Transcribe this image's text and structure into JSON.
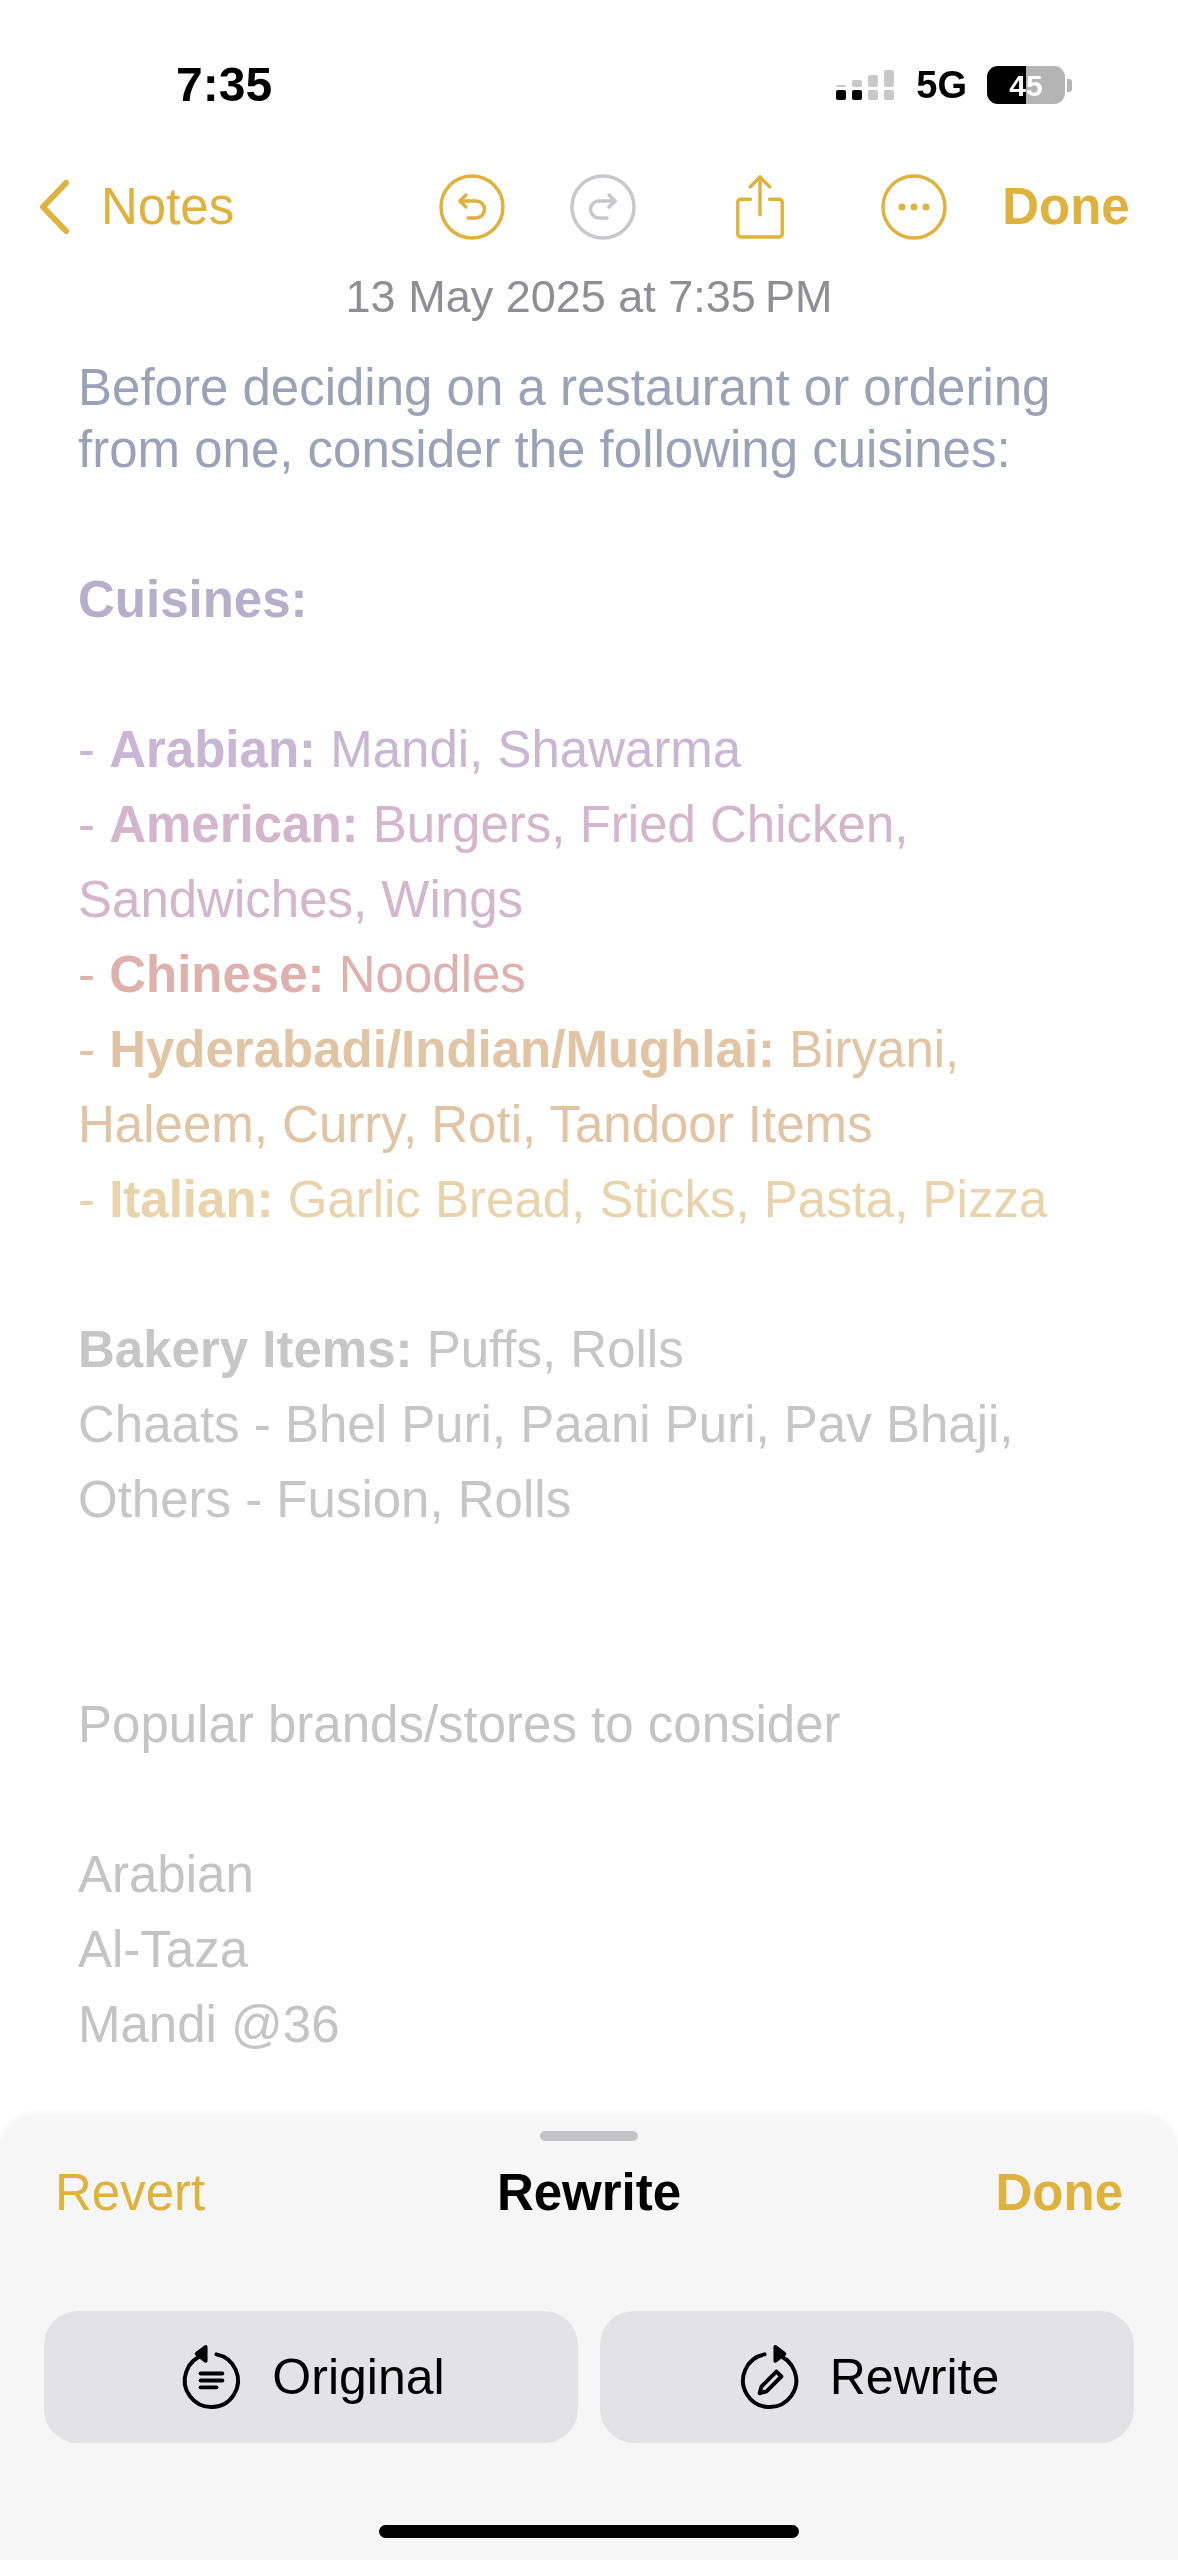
{
  "status_bar": {
    "time": "7:35",
    "network": "5G",
    "battery": "45"
  },
  "toolbar": {
    "back": {
      "label": "Notes"
    },
    "undo": {
      "disabled": false
    },
    "redo": {
      "disabled": true
    },
    "done": {
      "label": "Done"
    }
  },
  "note": {
    "date": "13 May 2025 at 7:35 PM",
    "blocks": [
      {
        "kind": "paragraph",
        "text": "Before deciding on a restaurant or ordering from one, consider the following cuisines:",
        "color": "#99a2b7"
      },
      {
        "kind": "heading",
        "text": "Cuisines:",
        "color": "#b6afc9"
      },
      {
        "kind": "list",
        "items": [
          {
            "text": "- **Arabian:** Mandi, Shawarma",
            "color": "#c8b6d3"
          },
          {
            "text": "- **American:** Burgers, Fried Chicken, Sandwiches, Wings",
            "color": "#d3b5cc"
          },
          {
            "text": "- **Chinese:** Noodles",
            "color": "#dfb1ac"
          },
          {
            "text": "- **Hyderabadi/Indian/Mughlai:** Biryani, Haleem, Curry, Roti, Tandoor Items",
            "color": "#e1c4a3"
          },
          {
            "text": "- **Italian:** Garlic Bread, Sticks, Pasta, Pizza",
            "color": "#e8d3ab"
          }
        ]
      },
      {
        "kind": "list",
        "items": [
          {
            "text": "**Bakery Items:** Puffs, Rolls",
            "color": "#c6c6c6"
          },
          {
            "text": "Chaats - Bhel Puri, Paani Puri, Pav Bhaji,",
            "color": "#c6c6c6"
          },
          {
            "text": "Others - Fusion, Rolls",
            "color": "#c6c6c6"
          }
        ]
      }
    ],
    "brands": {
      "title": "Popular brands/stores to consider",
      "color": "#c4c4c4",
      "lines": [
        "Arabian",
        "Al-Taza",
        "Mandi @36"
      ]
    }
  },
  "rewrite_sheet": {
    "revert": "Revert",
    "title": "Rewrite",
    "done": "Done",
    "options": [
      {
        "kind": "original",
        "label": "Original"
      },
      {
        "kind": "rewrite",
        "label": "Rewrite"
      }
    ]
  }
}
